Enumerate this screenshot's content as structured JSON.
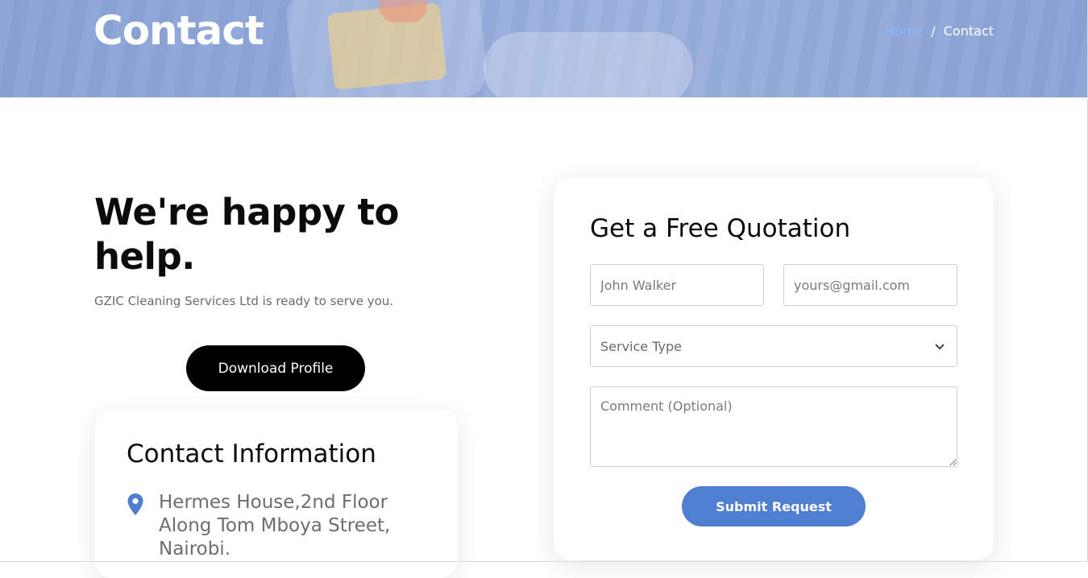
{
  "banner": {
    "title": "Contact",
    "breadcrumb": {
      "home": "Home",
      "separator": "/",
      "current": "Contact"
    }
  },
  "hero": {
    "heading": "We're happy to help.",
    "subtitle": "GZIC Cleaning Services Ltd is ready to serve you.",
    "download_label": "Download Profile"
  },
  "contact_info": {
    "title": "Contact Information",
    "address_line1": "Hermes House,2nd Floor",
    "address_line2": "Along Tom Mboya Street,",
    "address_line3": "Nairobi.",
    "icon": "location-pin-icon"
  },
  "quote_form": {
    "title": "Get a Free Quotation",
    "name_placeholder": "John Walker",
    "email_placeholder": "yours@gmail.com",
    "service_type": "Service Type",
    "comment_placeholder": "Comment (Optional)",
    "submit_label": "Submit Request"
  },
  "colors": {
    "accent": "#4e7fd1",
    "breadcrumb_home": "#8ab8ff",
    "banner": "#8ea6d9"
  }
}
